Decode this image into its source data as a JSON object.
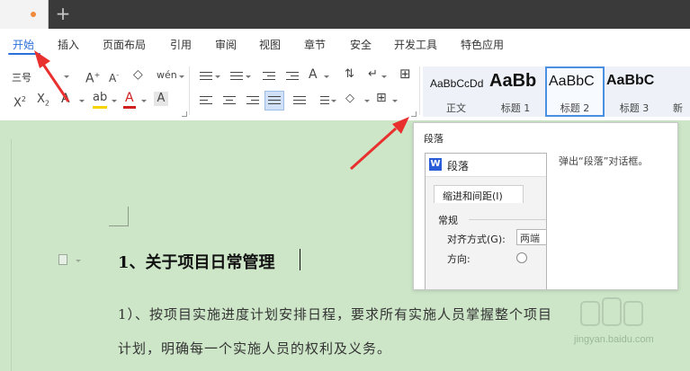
{
  "titlebar": {
    "new_tab_glyph": "+"
  },
  "menu": [
    {
      "label": "开始",
      "active": true
    },
    {
      "label": "插入"
    },
    {
      "label": "页面布局"
    },
    {
      "label": "引用"
    },
    {
      "label": "审阅"
    },
    {
      "label": "视图"
    },
    {
      "label": "章节"
    },
    {
      "label": "安全"
    },
    {
      "label": "开发工具"
    },
    {
      "label": "特色应用"
    }
  ],
  "ribbon": {
    "font_size": "三号",
    "styles": [
      {
        "sample": "AaBbCcDd",
        "name": "正文"
      },
      {
        "sample": "AaBb",
        "name": "标题 1"
      },
      {
        "sample": "AaBbC",
        "name": "标题 2",
        "selected": true
      },
      {
        "sample": "AaBbC",
        "name": "标题 3"
      },
      {
        "sample": "",
        "name": "新"
      }
    ],
    "colors": {
      "highlight": "#f5d400",
      "font_color": "#d02020",
      "accent": "#2b6fd8"
    }
  },
  "tooltip": {
    "title": "段落",
    "description": "弹出“段落”对话框。",
    "preview": {
      "window_title": "段落",
      "tab": "缩进和间距(I)",
      "section": "常规",
      "alignment_label": "对齐方式(G):",
      "alignment_value": "两端",
      "direction_label": "方向:"
    }
  },
  "document": {
    "heading": "1、关于项目日常管理",
    "body": [
      "1）、按项目实施进度计划安排日程，要求所有实施人员掌握整个项目",
      "计划，明确每一个实施人员的权利及义务。"
    ]
  },
  "watermark": {
    "text": "jingyan.baidu.com"
  }
}
